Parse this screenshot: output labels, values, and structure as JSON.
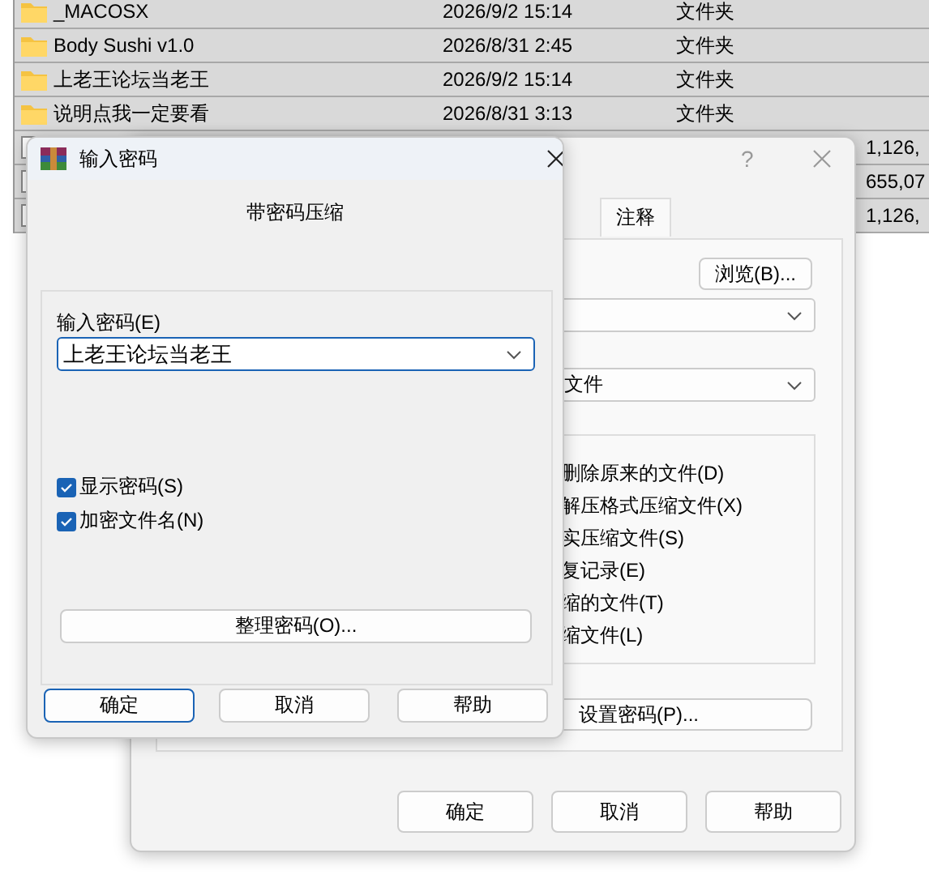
{
  "file_list": {
    "rows": [
      {
        "kind": "folder",
        "name": "_MACOSX",
        "modified": "2026/9/2 15:14",
        "type": "文件夹"
      },
      {
        "kind": "folder",
        "name": "Body Sushi v1.0",
        "modified": "2026/8/31 2:45",
        "type": "文件夹"
      },
      {
        "kind": "folder",
        "name": "上老王论坛当老王",
        "modified": "2026/9/2 15:14",
        "type": "文件夹"
      },
      {
        "kind": "folder",
        "name": "说明点我一定要看",
        "modified": "2026/8/31 3:13",
        "type": "文件夹"
      },
      {
        "kind": "file",
        "size": "1,126,"
      },
      {
        "kind": "file",
        "size": "655,07"
      },
      {
        "kind": "file",
        "size": "1,126,"
      }
    ]
  },
  "options_dialog": {
    "help_glyph": "?",
    "tabs": [
      {
        "label": "注释",
        "selected": true
      }
    ],
    "browse_button": "浏览(B)...",
    "format_combo": {
      "value": "文件"
    },
    "options": [
      "删除原来的文件(D)",
      "解压格式压缩文件(X)",
      "实压缩文件(S)",
      "复记录(E)",
      "缩的文件(T)",
      "缩文件(L)"
    ],
    "password_button": "设置密码(P)...",
    "buttons": [
      "确定",
      "取消",
      "帮助"
    ]
  },
  "password_dialog": {
    "title": "输入密码",
    "heading": "带密码压缩",
    "password_label": "输入密码(E)",
    "password": "上老王论坛当老王",
    "checkboxes": [
      {
        "label": "显示密码(S)",
        "checked": true
      },
      {
        "label": "加密文件名(N)",
        "checked": true
      }
    ],
    "organize_button": "整理密码(O)...",
    "buttons": [
      {
        "label": "确定",
        "default": true
      },
      {
        "label": "取消",
        "default": false
      },
      {
        "label": "帮助",
        "default": false
      }
    ]
  }
}
